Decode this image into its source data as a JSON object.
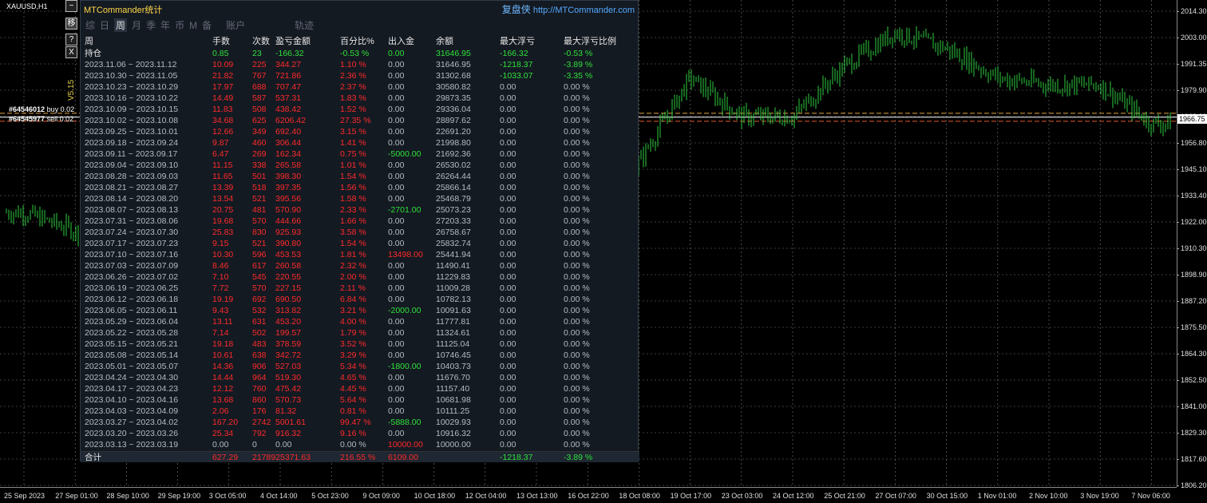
{
  "symbol": "XAUUSD,H1",
  "orders": [
    {
      "id": "#64546012",
      "side": "buy",
      "lots": "0.02"
    },
    {
      "id": "#64545977",
      "side": "sell",
      "lots": "0.02"
    }
  ],
  "side_buttons": [
    "",
    "移",
    "?",
    "X"
  ],
  "version": "V5.15",
  "price_axis": [
    "2014.30",
    "2003.00",
    "1991.35",
    "1979.90",
    "1968.60",
    "1956.80",
    "1945.10",
    "1933.40",
    "1922.00",
    "1910.30",
    "1898.90",
    "1887.20",
    "1875.50",
    "1864.30",
    "1852.50",
    "1841.00",
    "1829.30",
    "1817.60",
    "1806.20"
  ],
  "current_price": "1966.75",
  "time_axis": [
    "25 Sep 2023",
    "27 Sep 01:00",
    "28 Sep 10:00",
    "29 Sep 19:00",
    "3 Oct 05:00",
    "4 Oct 14:00",
    "5 Oct 23:00",
    "9 Oct 09:00",
    "10 Oct 18:00",
    "12 Oct 04:00",
    "13 Oct 13:00",
    "16 Oct 22:00",
    "18 Oct 08:00",
    "19 Oct 17:00",
    "23 Oct 03:00",
    "24 Oct 12:00",
    "25 Oct 21:00",
    "27 Oct 07:00",
    "30 Oct 15:00",
    "1 Nov 01:00",
    "2 Nov 10:00",
    "3 Nov 19:00",
    "7 Nov 06:00"
  ],
  "chart_data": {
    "type": "bar",
    "title": "XAUUSD,H1",
    "xlabel": "",
    "ylabel": "",
    "ylim": [
      1806.2,
      2014.3
    ],
    "grid": true,
    "price_keypoints": [
      {
        "x": "25 Sep 2023",
        "y": 1926
      },
      {
        "x": "27 Sep 01:00",
        "y": 1918
      },
      {
        "x": "28 Sep 10:00",
        "y": 1890
      },
      {
        "x": "12 Oct 04:00",
        "y": 1868
      },
      {
        "x": "18 Oct 08:00",
        "y": 1948
      },
      {
        "x": "19 Oct 17:00",
        "y": 1985
      },
      {
        "x": "23 Oct 03:00",
        "y": 1968
      },
      {
        "x": "24 Oct 12:00",
        "y": 1968
      },
      {
        "x": "25 Oct 21:00",
        "y": 1990
      },
      {
        "x": "27 Oct 07:00",
        "y": 2005
      },
      {
        "x": "30 Oct 15:00",
        "y": 1998
      },
      {
        "x": "1 Nov 01:00",
        "y": 1985
      },
      {
        "x": "2 Nov 10:00",
        "y": 1982
      },
      {
        "x": "3 Nov 19:00",
        "y": 1982
      },
      {
        "x": "7 Nov 06:00",
        "y": 1965
      }
    ],
    "price_lines": [
      {
        "value": 1969.5,
        "color": "#e8a33a"
      },
      {
        "value": 1967.8,
        "color": "#ffffff"
      },
      {
        "value": 1966.0,
        "color": "#e05a2a"
      }
    ]
  },
  "panel": {
    "title": "MTCommander统计",
    "replay_cn": "复盘侠",
    "replay_url": "http://MTCommander.com",
    "tabs": [
      "综",
      "日",
      "周",
      "月",
      "季",
      "年",
      "币",
      "M",
      "备",
      "账户",
      "轨迹"
    ],
    "active_tab": "周",
    "headers": [
      "周",
      "手数",
      "次数",
      "盈亏金额",
      "百分比%",
      "出入金",
      "余额",
      "最大浮亏",
      "最大浮亏比例"
    ],
    "hold": [
      "持仓",
      "0.85",
      "23",
      "-166.32",
      "-0.53 %",
      "0.00",
      "31646.95",
      "-166.32",
      "-0.53 %"
    ],
    "rows": [
      [
        "2023.11.06 ~ 2023.11.12",
        "10.09",
        "225",
        "344.27",
        "1.10 %",
        "0.00",
        "31646.95",
        "-1218.37",
        "-3.89 %"
      ],
      [
        "2023.10.30 ~ 2023.11.05",
        "21.82",
        "767",
        "721.86",
        "2.36 %",
        "0.00",
        "31302.68",
        "-1033.07",
        "-3.35 %"
      ],
      [
        "2023.10.23 ~ 2023.10.29",
        "17.97",
        "688",
        "707.47",
        "2.37 %",
        "0.00",
        "30580.82",
        "0.00",
        "0.00 %"
      ],
      [
        "2023.10.16 ~ 2023.10.22",
        "14.49",
        "587",
        "537.31",
        "1.83 %",
        "0.00",
        "29873.35",
        "0.00",
        "0.00 %"
      ],
      [
        "2023.10.09 ~ 2023.10.15",
        "11.83",
        "508",
        "438.42",
        "1.52 %",
        "0.00",
        "29336.04",
        "0.00",
        "0.00 %"
      ],
      [
        "2023.10.02 ~ 2023.10.08",
        "34.68",
        "625",
        "6206.42",
        "27.35 %",
        "0.00",
        "28897.62",
        "0.00",
        "0.00 %"
      ],
      [
        "2023.09.25 ~ 2023.10.01",
        "12.66",
        "349",
        "692.40",
        "3.15 %",
        "0.00",
        "22691.20",
        "0.00",
        "0.00 %"
      ],
      [
        "2023.09.18 ~ 2023.09.24",
        "9.87",
        "460",
        "306.44",
        "1.41 %",
        "0.00",
        "21998.80",
        "0.00",
        "0.00 %"
      ],
      [
        "2023.09.11 ~ 2023.09.17",
        "6.47",
        "269",
        "162.34",
        "0.75 %",
        "-5000.00",
        "21692.36",
        "0.00",
        "0.00 %"
      ],
      [
        "2023.09.04 ~ 2023.09.10",
        "11.15",
        "338",
        "265.58",
        "1.01 %",
        "0.00",
        "26530.02",
        "0.00",
        "0.00 %"
      ],
      [
        "2023.08.28 ~ 2023.09.03",
        "11.65",
        "501",
        "398.30",
        "1.54 %",
        "0.00",
        "26264.44",
        "0.00",
        "0.00 %"
      ],
      [
        "2023.08.21 ~ 2023.08.27",
        "13.39",
        "518",
        "397.35",
        "1.56 %",
        "0.00",
        "25866.14",
        "0.00",
        "0.00 %"
      ],
      [
        "2023.08.14 ~ 2023.08.20",
        "13.54",
        "521",
        "395.56",
        "1.58 %",
        "0.00",
        "25468.79",
        "0.00",
        "0.00 %"
      ],
      [
        "2023.08.07 ~ 2023.08.13",
        "20.75",
        "481",
        "570.90",
        "2.33 %",
        "-2701.00",
        "25073.23",
        "0.00",
        "0.00 %"
      ],
      [
        "2023.07.31 ~ 2023.08.06",
        "19.68",
        "570",
        "444.66",
        "1.66 %",
        "0.00",
        "27203.33",
        "0.00",
        "0.00 %"
      ],
      [
        "2023.07.24 ~ 2023.07.30",
        "25.83",
        "830",
        "925.93",
        "3.58 %",
        "0.00",
        "26758.67",
        "0.00",
        "0.00 %"
      ],
      [
        "2023.07.17 ~ 2023.07.23",
        "9.15",
        "521",
        "390.80",
        "1.54 %",
        "0.00",
        "25832.74",
        "0.00",
        "0.00 %"
      ],
      [
        "2023.07.10 ~ 2023.07.16",
        "10.30",
        "596",
        "453.53",
        "1.81 %",
        "13498.00",
        "25441.94",
        "0.00",
        "0.00 %"
      ],
      [
        "2023.07.03 ~ 2023.07.09",
        "8.46",
        "617",
        "260.58",
        "2.32 %",
        "0.00",
        "11490.41",
        "0.00",
        "0.00 %"
      ],
      [
        "2023.06.26 ~ 2023.07.02",
        "7.10",
        "545",
        "220.55",
        "2.00 %",
        "0.00",
        "11229.83",
        "0.00",
        "0.00 %"
      ],
      [
        "2023.06.19 ~ 2023.06.25",
        "7.72",
        "570",
        "227.15",
        "2.11 %",
        "0.00",
        "11009.28",
        "0.00",
        "0.00 %"
      ],
      [
        "2023.06.12 ~ 2023.06.18",
        "19.19",
        "692",
        "690.50",
        "6.84 %",
        "0.00",
        "10782.13",
        "0.00",
        "0.00 %"
      ],
      [
        "2023.06.05 ~ 2023.06.11",
        "9.43",
        "532",
        "313.82",
        "3.21 %",
        "-2000.00",
        "10091.63",
        "0.00",
        "0.00 %"
      ],
      [
        "2023.05.29 ~ 2023.06.04",
        "13.11",
        "631",
        "453.20",
        "4.00 %",
        "0.00",
        "11777.81",
        "0.00",
        "0.00 %"
      ],
      [
        "2023.05.22 ~ 2023.05.28",
        "7.14",
        "502",
        "199.57",
        "1.79 %",
        "0.00",
        "11324.61",
        "0.00",
        "0.00 %"
      ],
      [
        "2023.05.15 ~ 2023.05.21",
        "19.18",
        "483",
        "378.59",
        "3.52 %",
        "0.00",
        "11125.04",
        "0.00",
        "0.00 %"
      ],
      [
        "2023.05.08 ~ 2023.05.14",
        "10.61",
        "638",
        "342.72",
        "3.29 %",
        "0.00",
        "10746.45",
        "0.00",
        "0.00 %"
      ],
      [
        "2023.05.01 ~ 2023.05.07",
        "14.36",
        "906",
        "527.03",
        "5.34 %",
        "-1800.00",
        "10403.73",
        "0.00",
        "0.00 %"
      ],
      [
        "2023.04.24 ~ 2023.04.30",
        "14.44",
        "964",
        "519.30",
        "4.65 %",
        "0.00",
        "11676.70",
        "0.00",
        "0.00 %"
      ],
      [
        "2023.04.17 ~ 2023.04.23",
        "12.12",
        "760",
        "475.42",
        "4.45 %",
        "0.00",
        "11157.40",
        "0.00",
        "0.00 %"
      ],
      [
        "2023.04.10 ~ 2023.04.16",
        "13.68",
        "860",
        "570.73",
        "5.64 %",
        "0.00",
        "10681.98",
        "0.00",
        "0.00 %"
      ],
      [
        "2023.04.03 ~ 2023.04.09",
        "2.06",
        "176",
        "81.32",
        "0.81 %",
        "0.00",
        "10111.25",
        "0.00",
        "0.00 %"
      ],
      [
        "2023.03.27 ~ 2023.04.02",
        "167.20",
        "2742",
        "5001.61",
        "99.47 %",
        "-5888.00",
        "10029.93",
        "0.00",
        "0.00 %"
      ],
      [
        "2023.03.20 ~ 2023.03.26",
        "25.34",
        "792",
        "916.32",
        "9.16 %",
        "0.00",
        "10916.32",
        "0.00",
        "0.00 %"
      ],
      [
        "2023.03.13 ~ 2023.03.19",
        "0.00",
        "0",
        "0.00",
        "0.00 %",
        "10000.00",
        "10000.00",
        "0.00",
        "0.00 %"
      ]
    ],
    "totals": {
      "label": "合计",
      "lots": "627.29",
      "count_amount": "2178925371.63",
      "pct": "216.55 %",
      "flow": "6109.00",
      "balance": "",
      "max_dd": "-1218.37",
      "max_dd_pct": "-3.89 %"
    },
    "colors": {
      "loss": "#ff2a2a",
      "gain": "#2fe03a",
      "neutral": "#b5bcc4",
      "title": "#ffd84a",
      "link": "#55aaff"
    }
  }
}
